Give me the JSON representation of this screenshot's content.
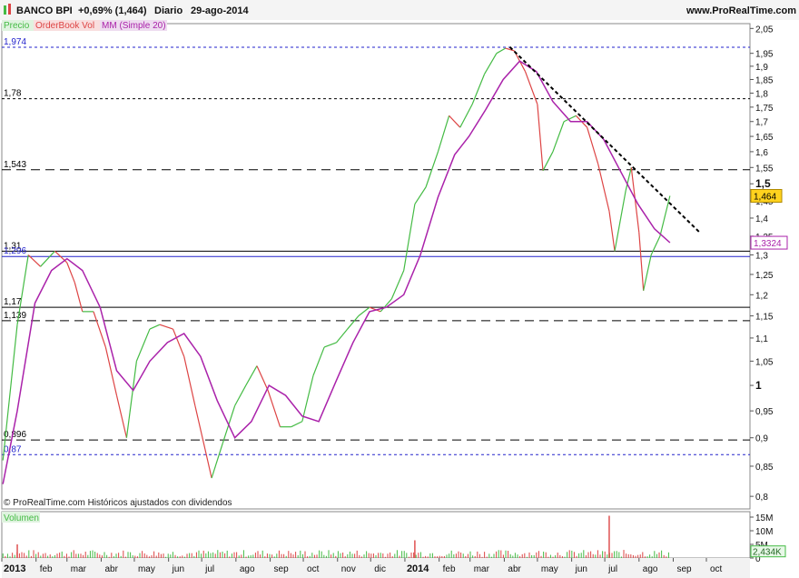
{
  "header": {
    "ticker": "BANCO BPI",
    "change": "+0,69% (1,464)",
    "period": "Diario",
    "date": "29-ago-2014",
    "site": "www.ProRealTime.com"
  },
  "legend": {
    "price": "Precio",
    "orderbook": "OrderBook Vol",
    "mm": "MM (Simple 20)"
  },
  "watermark": "© ProRealTime.com  Históricos ajustados con dividendos",
  "volume_label": "Volumen",
  "current_price": "1,464",
  "current_mm": "1,3324",
  "current_volume": "2,434K",
  "colors": {
    "up": "#44bb44",
    "down": "#dd4444",
    "mm": "#aa22aa",
    "blue": "#2222cc",
    "price_tag": "#ffd21e",
    "mm_tag_border": "#aa22aa"
  },
  "chart_data": {
    "type": "line",
    "x_months": [
      "2013",
      "feb",
      "mar",
      "abr",
      "may",
      "jun",
      "jul",
      "ago",
      "sep",
      "oct",
      "nov",
      "dic",
      "2014",
      "feb",
      "mar",
      "abr",
      "may",
      "jun",
      "jul",
      "ago",
      "sep",
      "oct"
    ],
    "y_ticks": [
      "2,05",
      "1,95",
      "1,9",
      "1,85",
      "1,8",
      "1,75",
      "1,7",
      "1,65",
      "1,6",
      "1,55",
      "1,5",
      "1,45",
      "1,4",
      "1,35",
      "1,3",
      "1,25",
      "1,2",
      "1,15",
      "1,1",
      "1,05",
      "1",
      "0,95",
      "0,9",
      "0,85",
      "0,8"
    ],
    "volume_ticks": [
      "15M",
      "10M",
      "5M",
      "0"
    ],
    "horizontal_levels": [
      {
        "label": "1,974",
        "value": 1.974,
        "style": "blue-dash"
      },
      {
        "label": "1,78",
        "value": 1.78,
        "style": "black-dash"
      },
      {
        "label": "1,543",
        "value": 1.543,
        "style": "black-longdash"
      },
      {
        "label": "1,31",
        "value": 1.31,
        "style": "black-solid"
      },
      {
        "label": "1,296",
        "value": 1.296,
        "style": "blue-solid"
      },
      {
        "label": "1,17",
        "value": 1.17,
        "style": "black-solid"
      },
      {
        "label": "1,139",
        "value": 1.139,
        "style": "black-longdash"
      },
      {
        "label": "0,896",
        "value": 0.896,
        "style": "black-longdash"
      },
      {
        "label": "0,87",
        "value": 0.87,
        "style": "blue-dash"
      }
    ],
    "trendline": {
      "from": [
        "abr 2014",
        1.975
      ],
      "to": [
        "sep 2014",
        1.36
      ]
    },
    "price_series": [
      [
        "2013-01-02",
        0.86
      ],
      [
        "2013-01-15",
        1.13
      ],
      [
        "2013-01-25",
        1.3
      ],
      [
        "2013-02-05",
        1.27
      ],
      [
        "2013-02-18",
        1.31
      ],
      [
        "2013-03-01",
        1.28
      ],
      [
        "2013-03-08",
        1.23
      ],
      [
        "2013-03-15",
        1.16
      ],
      [
        "2013-03-25",
        1.16
      ],
      [
        "2013-04-05",
        1.08
      ],
      [
        "2013-04-15",
        0.98
      ],
      [
        "2013-04-24",
        0.9
      ],
      [
        "2013-05-03",
        1.05
      ],
      [
        "2013-05-15",
        1.12
      ],
      [
        "2013-05-24",
        1.13
      ],
      [
        "2013-06-05",
        1.12
      ],
      [
        "2013-06-15",
        1.06
      ],
      [
        "2013-06-25",
        0.96
      ],
      [
        "2013-07-04",
        0.88
      ],
      [
        "2013-07-10",
        0.83
      ],
      [
        "2013-07-20",
        0.89
      ],
      [
        "2013-07-31",
        0.96
      ],
      [
        "2013-08-10",
        1.0
      ],
      [
        "2013-08-20",
        1.04
      ],
      [
        "2013-08-30",
        0.99
      ],
      [
        "2013-09-10",
        0.92
      ],
      [
        "2013-09-20",
        0.92
      ],
      [
        "2013-09-30",
        0.93
      ],
      [
        "2013-10-10",
        1.02
      ],
      [
        "2013-10-20",
        1.08
      ],
      [
        "2013-10-31",
        1.09
      ],
      [
        "2013-11-10",
        1.12
      ],
      [
        "2013-11-20",
        1.15
      ],
      [
        "2013-11-30",
        1.17
      ],
      [
        "2013-12-10",
        1.16
      ],
      [
        "2013-12-20",
        1.19
      ],
      [
        "2013-12-31",
        1.26
      ],
      [
        "2014-01-10",
        1.44
      ],
      [
        "2014-01-20",
        1.49
      ],
      [
        "2014-01-31",
        1.6
      ],
      [
        "2014-02-10",
        1.72
      ],
      [
        "2014-02-20",
        1.68
      ],
      [
        "2014-03-03",
        1.76
      ],
      [
        "2014-03-14",
        1.87
      ],
      [
        "2014-03-25",
        1.95
      ],
      [
        "2014-04-02",
        1.97
      ],
      [
        "2014-04-10",
        1.96
      ],
      [
        "2014-04-20",
        1.88
      ],
      [
        "2014-05-01",
        1.76
      ],
      [
        "2014-05-06",
        1.54
      ],
      [
        "2014-05-15",
        1.6
      ],
      [
        "2014-05-25",
        1.7
      ],
      [
        "2014-06-05",
        1.72
      ],
      [
        "2014-06-15",
        1.68
      ],
      [
        "2014-06-25",
        1.56
      ],
      [
        "2014-07-05",
        1.42
      ],
      [
        "2014-07-10",
        1.31
      ],
      [
        "2014-07-20",
        1.48
      ],
      [
        "2014-07-25",
        1.55
      ],
      [
        "2014-08-01",
        1.36
      ],
      [
        "2014-08-05",
        1.21
      ],
      [
        "2014-08-12",
        1.3
      ],
      [
        "2014-08-20",
        1.35
      ],
      [
        "2014-08-29",
        1.464
      ]
    ],
    "mm_series": [
      [
        "2013-01-02",
        0.82
      ],
      [
        "2013-01-15",
        0.95
      ],
      [
        "2013-01-31",
        1.18
      ],
      [
        "2013-02-15",
        1.26
      ],
      [
        "2013-03-01",
        1.29
      ],
      [
        "2013-03-15",
        1.26
      ],
      [
        "2013-03-31",
        1.17
      ],
      [
        "2013-04-15",
        1.03
      ],
      [
        "2013-04-30",
        0.99
      ],
      [
        "2013-05-15",
        1.05
      ],
      [
        "2013-05-31",
        1.09
      ],
      [
        "2013-06-15",
        1.11
      ],
      [
        "2013-06-30",
        1.06
      ],
      [
        "2013-07-15",
        0.97
      ],
      [
        "2013-07-31",
        0.9
      ],
      [
        "2013-08-15",
        0.93
      ],
      [
        "2013-08-31",
        1.0
      ],
      [
        "2013-09-15",
        0.98
      ],
      [
        "2013-09-30",
        0.94
      ],
      [
        "2013-10-15",
        0.93
      ],
      [
        "2013-10-31",
        1.01
      ],
      [
        "2013-11-15",
        1.09
      ],
      [
        "2013-11-30",
        1.16
      ],
      [
        "2013-12-15",
        1.17
      ],
      [
        "2013-12-31",
        1.2
      ],
      [
        "2014-01-15",
        1.3
      ],
      [
        "2014-01-31",
        1.46
      ],
      [
        "2014-02-15",
        1.59
      ],
      [
        "2014-02-28",
        1.65
      ],
      [
        "2014-03-15",
        1.74
      ],
      [
        "2014-03-31",
        1.85
      ],
      [
        "2014-04-15",
        1.92
      ],
      [
        "2014-04-30",
        1.88
      ],
      [
        "2014-05-15",
        1.77
      ],
      [
        "2014-05-31",
        1.7
      ],
      [
        "2014-06-15",
        1.7
      ],
      [
        "2014-06-30",
        1.64
      ],
      [
        "2014-07-15",
        1.54
      ],
      [
        "2014-07-31",
        1.44
      ],
      [
        "2014-08-15",
        1.37
      ],
      [
        "2014-08-29",
        1.3324
      ]
    ],
    "volume_spikes": [
      [
        "2014-07-05",
        15.5
      ],
      [
        "2014-01-10",
        6.5
      ],
      [
        "2013-01-15",
        5.0
      ]
    ]
  }
}
